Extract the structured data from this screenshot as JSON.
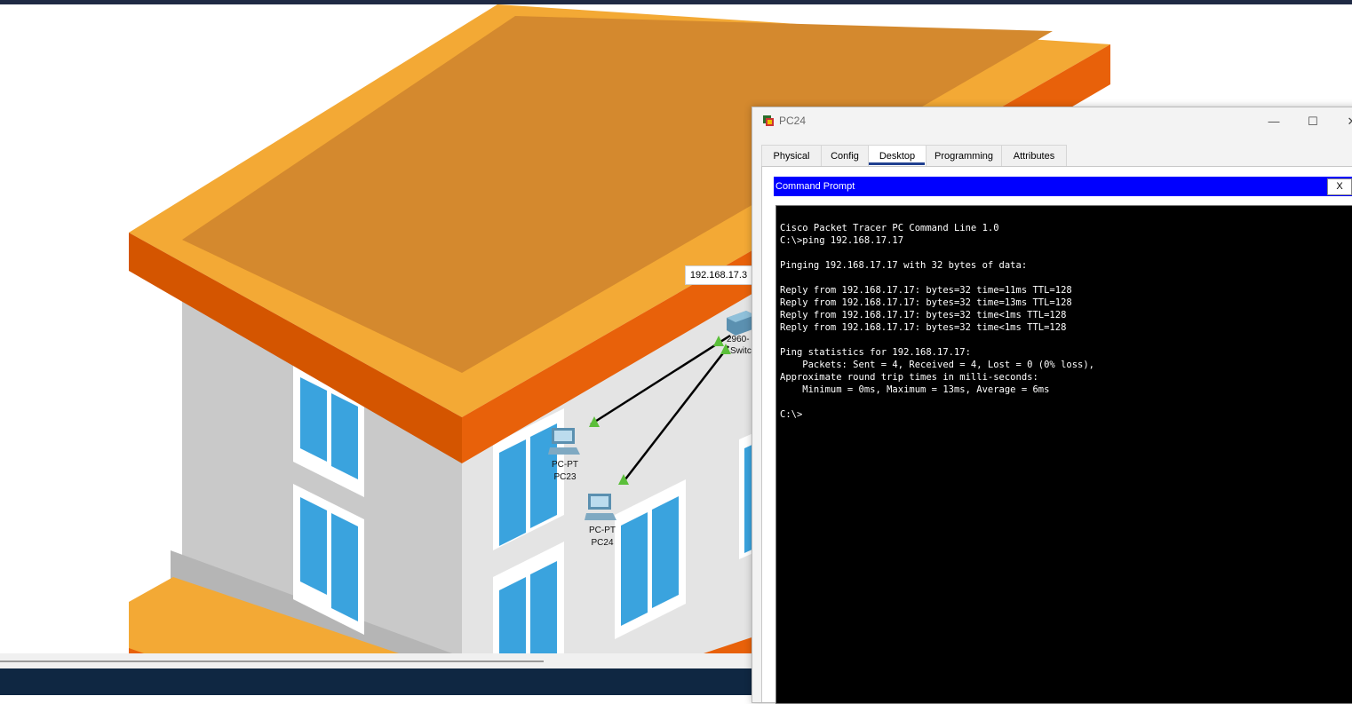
{
  "window": {
    "title": "PC24",
    "controls": {
      "minimize": "—",
      "maximize": "☐",
      "close": "✕"
    }
  },
  "tabs": [
    {
      "label": "Physical",
      "active": false
    },
    {
      "label": "Config",
      "active": false
    },
    {
      "label": "Desktop",
      "active": true
    },
    {
      "label": "Programming",
      "active": false
    },
    {
      "label": "Attributes",
      "active": false
    }
  ],
  "command_prompt": {
    "title": "Command Prompt",
    "close_label": "X",
    "lines": [
      "Cisco Packet Tracer PC Command Line 1.0",
      "C:\\>ping 192.168.17.17",
      "",
      "Pinging 192.168.17.17 with 32 bytes of data:",
      "",
      "Reply from 192.168.17.17: bytes=32 time=11ms TTL=128",
      "Reply from 192.168.17.17: bytes=32 time=13ms TTL=128",
      "Reply from 192.168.17.17: bytes=32 time<1ms TTL=128",
      "Reply from 192.168.17.17: bytes=32 time<1ms TTL=128",
      "",
      "Ping statistics for 192.168.17.17:",
      "    Packets: Sent = 4, Received = 4, Lost = 0 (0% loss),",
      "Approximate round trip times in milli-seconds:",
      "    Minimum = 0ms, Maximum = 13ms, Average = 6ms",
      "",
      "C:\\>"
    ]
  },
  "topology": {
    "ip_tooltip": "192.168.17.3",
    "devices": [
      {
        "type": "PC-PT",
        "name": "PC23"
      },
      {
        "type": "PC-PT",
        "name": "PC24"
      }
    ],
    "switch": {
      "model_partial": "2960-",
      "name_partial": "Switc"
    }
  },
  "colors": {
    "roof_top": "#d4892e",
    "roof_rim": "#f3a935",
    "roof_edge": "#e8610a",
    "wall_light": "#e6e6e6",
    "wall_mid": "#c9c9c9",
    "window_glass": "#3aa3de",
    "link_up": "#5bbf3a",
    "cp_header": "#0000ff",
    "terminal_bg": "#000000"
  }
}
